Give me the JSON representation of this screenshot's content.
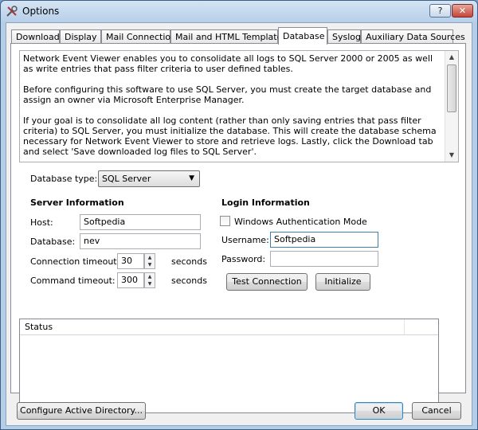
{
  "window": {
    "title": "Options",
    "help_label": "?",
    "close_label": "✕"
  },
  "tabs": [
    {
      "label": "Download"
    },
    {
      "label": "Display"
    },
    {
      "label": "Mail Connection"
    },
    {
      "label": "Mail and HTML Templates"
    },
    {
      "label": "Database"
    },
    {
      "label": "Syslog"
    },
    {
      "label": "Auxiliary Data Sources"
    }
  ],
  "info": {
    "p1": "Network Event Viewer enables you to consolidate all logs to SQL Server 2000 or 2005 as well as write entries that pass filter criteria to user defined tables.",
    "p2": "Before configuring this software to use SQL Server, you must create the target database and assign an owner via Microsoft Enterprise Manager.",
    "p3": "If your goal is to consolidate all log content (rather than only saving entries that pass filter criteria) to SQL Server, you must initialize the database.  This will create the database schema necessary for Network Event Viewer to store and retrieve logs.  Lastly, click the Download tab and select 'Save downloaded log files to SQL Server'."
  },
  "db_type": {
    "label": "Database type:",
    "value": "SQL Server"
  },
  "server": {
    "heading": "Server Information",
    "host_label": "Host:",
    "host_value": "Softpedia",
    "database_label": "Database:",
    "database_value": "nev",
    "conn_timeout_label": "Connection timeout:",
    "conn_timeout_value": "30",
    "cmd_timeout_label": "Command timeout:",
    "cmd_timeout_value": "300",
    "seconds_label": "seconds"
  },
  "login": {
    "heading": "Login Information",
    "windows_auth_label": "Windows Authentication Mode",
    "windows_auth_checked": false,
    "username_label": "Username:",
    "username_value": "Softpedia",
    "password_label": "Password:",
    "password_value": ""
  },
  "actions": {
    "test_connection": "Test Connection",
    "initialize": "Initialize"
  },
  "status": {
    "header": "Status"
  },
  "footer": {
    "configure_ad": "Configure Active Directory...",
    "ok": "OK",
    "cancel": "Cancel"
  }
}
